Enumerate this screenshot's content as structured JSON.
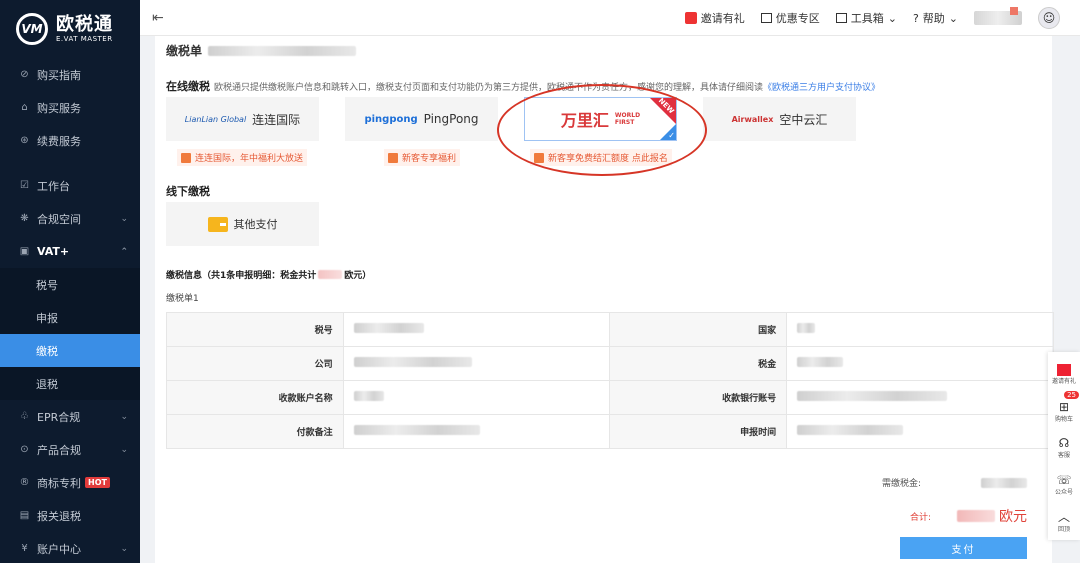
{
  "brand": {
    "name_cn": "欧税通",
    "name_en": "E.VAT MASTER",
    "mark": "VM"
  },
  "sidebar": {
    "items": [
      {
        "label": "购买指南",
        "icon": "compass-icon",
        "glyph": "⊘"
      },
      {
        "label": "购买服务",
        "icon": "bag-icon",
        "glyph": "⌂"
      },
      {
        "label": "续费服务",
        "icon": "refresh-icon",
        "glyph": "⊛"
      },
      {
        "label": "工作台",
        "icon": "desk-icon",
        "glyph": "☑"
      },
      {
        "label": "合规空间",
        "icon": "space-icon",
        "glyph": "❋",
        "chev": "⌄"
      },
      {
        "label": "VAT+",
        "icon": "briefcase-icon",
        "glyph": "▣",
        "chev": "⌃"
      },
      {
        "label": "税号"
      },
      {
        "label": "申报"
      },
      {
        "label": "缴税"
      },
      {
        "label": "退税"
      },
      {
        "label": "EPR合规",
        "icon": "leaf-icon",
        "glyph": "♧",
        "chev": "⌄"
      },
      {
        "label": "产品合规",
        "icon": "shield-icon",
        "glyph": "⊙",
        "chev": "⌄"
      },
      {
        "label": "商标专利",
        "icon": "badge-icon",
        "glyph": "®",
        "hot": "HOT"
      },
      {
        "label": "报关退税",
        "icon": "doc-icon",
        "glyph": "▤"
      },
      {
        "label": "账户中心",
        "icon": "account-icon",
        "glyph": "¥",
        "chev": "⌄"
      }
    ]
  },
  "topbar": {
    "menu_toggle": "⇤",
    "invite": "邀请有礼",
    "discount": "优惠专区",
    "toolbox": "工具箱",
    "help": "帮助",
    "chev": "⌄",
    "help_glyph": "?",
    "avatar_glyph": "☺"
  },
  "main": {
    "bill_title": "缴税单",
    "online_title": "在线缴税",
    "online_notice": "欧税通只提供缴税账户信息和跳转入口，缴税支付页面和支付功能仍为第三方提供，欧税通不作为责任方，感谢您的理解，具体请仔细阅读",
    "online_notice_link": "《欧税通三方用户支付协议》",
    "providers": [
      {
        "logo": "LianLian Global",
        "name": "连连国际",
        "promo": "连连国际，年中福利大放送"
      },
      {
        "logo": "pingpong",
        "name": "PingPong",
        "promo": "新客专享福利"
      },
      {
        "logo_cn": "万里汇",
        "logo_en1": "WORLD",
        "logo_en2": "FIRST",
        "badge": "NEW",
        "check": "✓",
        "promo": "新客享免费结汇额度 点此报名"
      },
      {
        "logo": "Airwallex",
        "name": "空中云汇"
      }
    ],
    "offline_title": "线下缴税",
    "offline_other": "其他支付",
    "info_head_prefix": "缴税信息（共1条申报明细：税金共计",
    "info_head_suffix": "欧元）",
    "bill_sub": "缴税单1",
    "rows": [
      {
        "l1": "税号",
        "l2": "国家"
      },
      {
        "l1": "公司",
        "l2": "税金"
      },
      {
        "l1": "收款账户名称",
        "l2": "收款银行账号"
      },
      {
        "l1": "付款备注",
        "l2": "申报时间"
      }
    ],
    "due_label": "需缴税金:",
    "total_label": "合计:",
    "total_unit": "欧元",
    "pay_button": "支付"
  },
  "float_bar": {
    "invite": "邀请有礼",
    "cart": "购物车",
    "cart_count": "25",
    "service": "客服",
    "wechat": "公众号",
    "top": "回顶",
    "cart_glyph": "⊞",
    "service_glyph": "☊",
    "wechat_glyph": "☏",
    "top_glyph": "︿"
  }
}
